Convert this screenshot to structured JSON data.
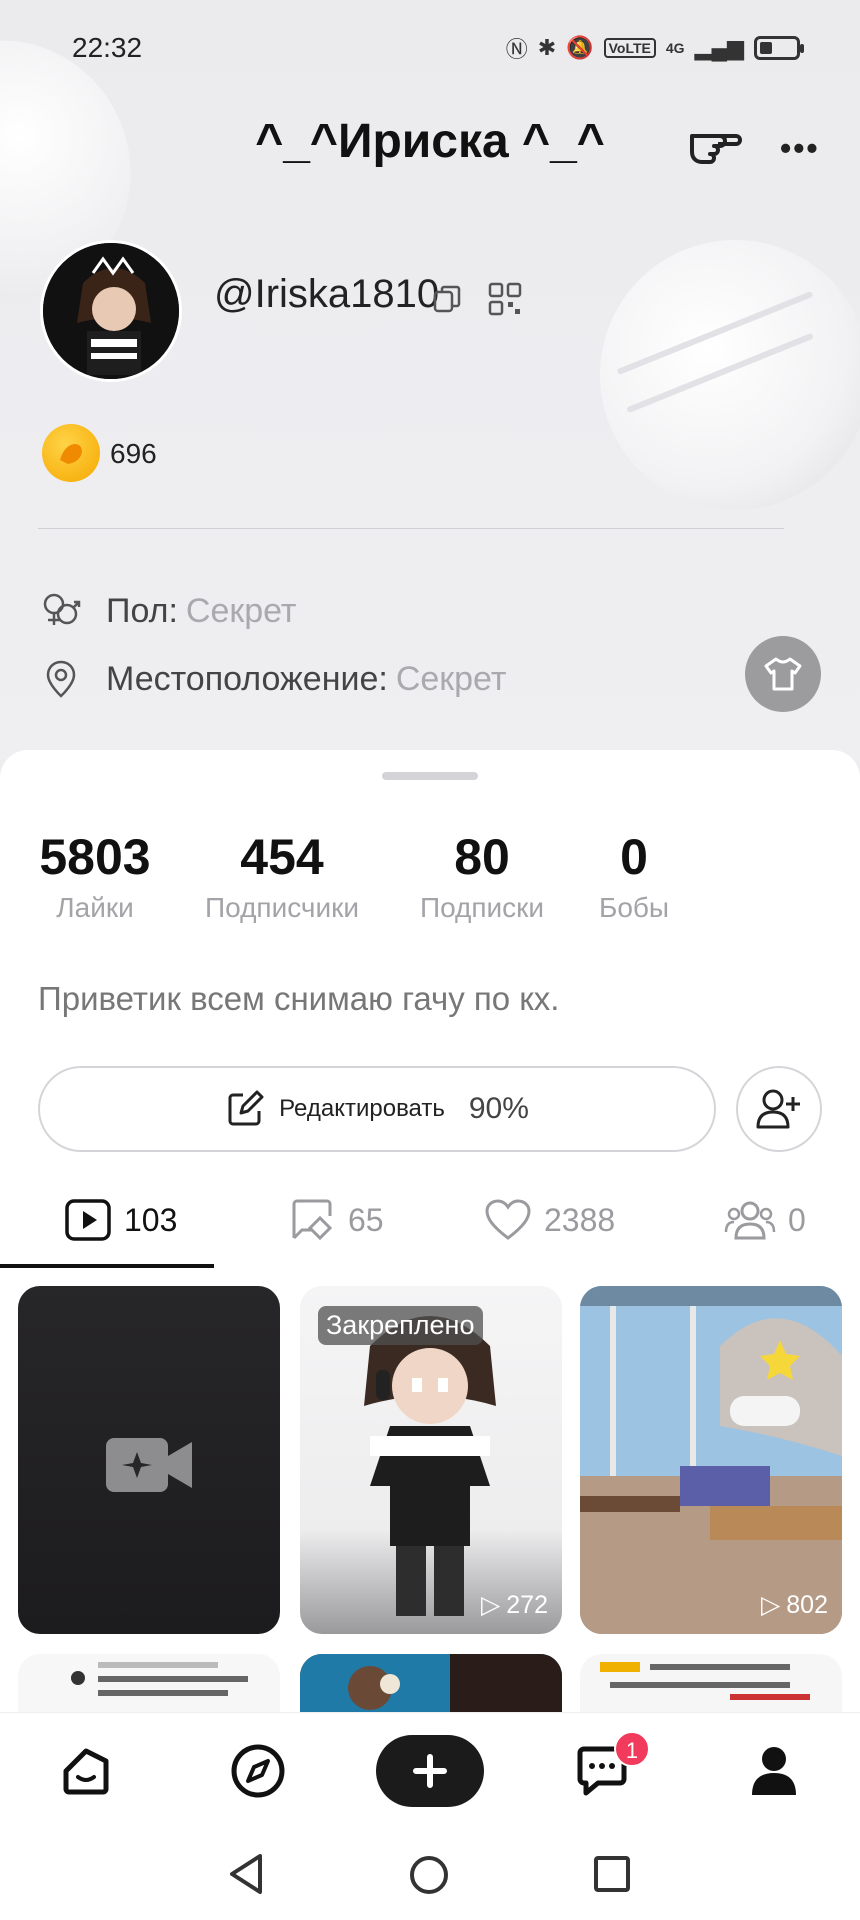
{
  "status_bar": {
    "time": "22:32",
    "network": "4G",
    "volte": "VoLTE"
  },
  "header": {
    "title": "^_^Ириска ^_^"
  },
  "profile": {
    "username": "@Iriska1810",
    "coins": "696",
    "gender_label": "Пол:",
    "gender_value": "Секрет",
    "location_label": "Местоположение:",
    "location_value": "Секрет"
  },
  "stats": [
    {
      "value": "5803",
      "label": "Лайки"
    },
    {
      "value": "454",
      "label": "Подписчики"
    },
    {
      "value": "80",
      "label": "Подписки"
    },
    {
      "value": "0",
      "label": "Бобы"
    }
  ],
  "bio": "Приветик всем снимаю гачу по кх.",
  "edit": {
    "label": "Редактировать",
    "percent": "90%"
  },
  "tabs": [
    {
      "icon": "video-icon",
      "count": "103"
    },
    {
      "icon": "repost-icon",
      "count": "65"
    },
    {
      "icon": "heart-icon",
      "count": "2388"
    },
    {
      "icon": "group-icon",
      "count": "0"
    }
  ],
  "videos": [
    {
      "type": "create"
    },
    {
      "pinned_label": "Закреплено",
      "views": "272"
    },
    {
      "views": "802"
    }
  ],
  "bottom_nav": {
    "messages_badge": "1"
  },
  "colors": {
    "accent": "#f23b5c",
    "coin": "#f5a800",
    "dark": "#1b1b1b"
  }
}
